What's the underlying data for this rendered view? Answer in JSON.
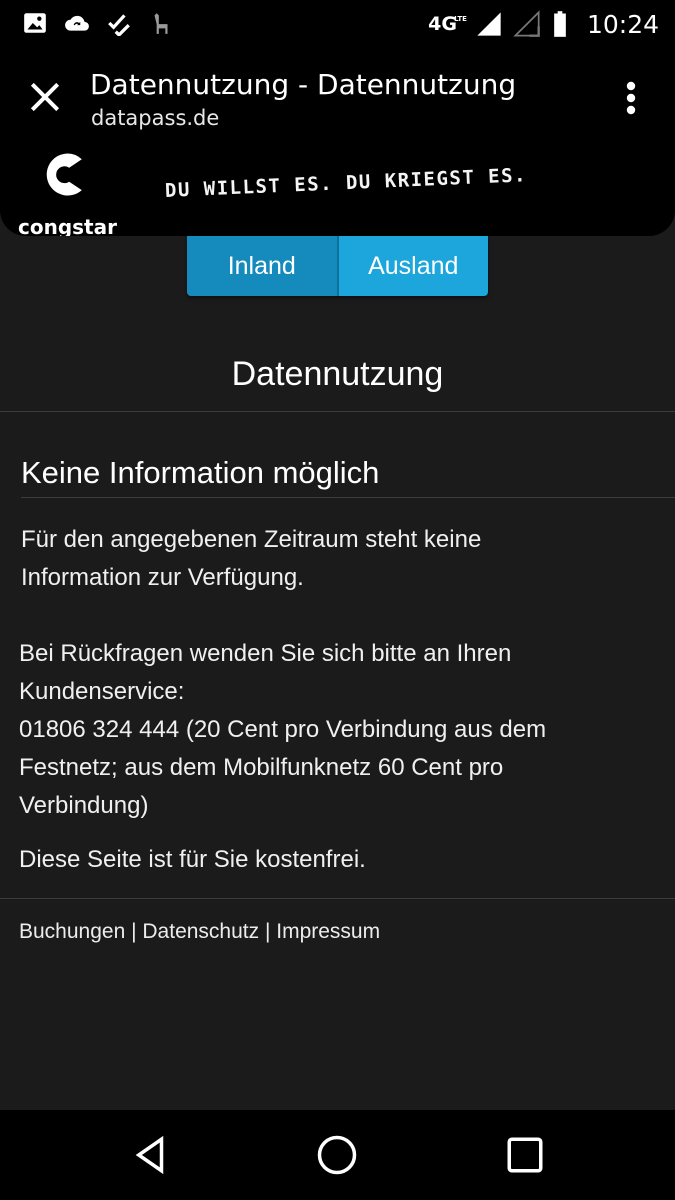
{
  "status_bar": {
    "network": "4G",
    "network_sub": "LTE",
    "time": "10:24",
    "icons": [
      "image-icon",
      "cloud-sync-icon",
      "checklist-icon",
      "llama-icon",
      "signal-icon",
      "signal-empty-icon",
      "battery-icon"
    ]
  },
  "header": {
    "title": "Datennutzung - Datennutzung",
    "url": "datapass.de"
  },
  "brand": {
    "name": "congstar",
    "slogan": "DU WILLST ES. DU KRIEGST ES."
  },
  "tabs": [
    {
      "label": "Inland"
    },
    {
      "label": "Ausland"
    }
  ],
  "page": {
    "heading": "Datennutzung",
    "section_title": "Keine Information möglich",
    "para1": [
      "Für den angegebenen Zeitraum steht keine",
      "Information zur Verfügung."
    ],
    "para2": [
      "Bei Rückfragen wenden Sie sich bitte an Ihren",
      "Kundenservice:",
      "01806 324 444  (20 Cent pro Verbindung aus dem",
      "Festnetz; aus dem Mobilfunknetz 60 Cent pro",
      "Verbindung)"
    ],
    "para3": "Diese Seite ist für Sie kostenfrei."
  },
  "footer": {
    "links": [
      "Buchungen",
      "Datenschutz",
      "Impressum"
    ],
    "separator": " | "
  },
  "colors": {
    "accent": "#1ca6dc",
    "background": "#1b1b1b"
  }
}
